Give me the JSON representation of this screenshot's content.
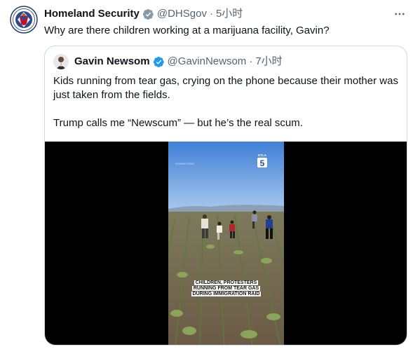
{
  "tweet": {
    "author_name": "Homeland Security",
    "handle": "@DHSgov",
    "separator": "·",
    "time": "5小时",
    "text": "Why are there children working at a marijuana facility, Gavin?",
    "avatar_icon": "dhs-seal-icon",
    "badge_icon": "gray-verified-badge-icon",
    "more_icon": "more-horizontal-icon"
  },
  "quote": {
    "author_name": "Gavin Newsom",
    "handle": "@GavinNewsom",
    "separator": "·",
    "time": "7小时",
    "badge_icon": "blue-verified-badge-icon",
    "text_line1": "Kids running from tear gas, crying on the phone because their mother was just taken from the fields.",
    "text_line2": "Trump calls me “Newscum” — but he’s the real scum.",
    "video": {
      "channel_logo_text": "KTLA 5",
      "caption": "CHILDREN, PROTESTERS RUNNING FROM TEAR GAS DURING IMMIGRATION RAID",
      "watermark": "NYMENTIONS"
    }
  },
  "colors": {
    "text": "#0f1419",
    "muted": "#536471",
    "border": "#cfd9de",
    "verified_blue": "#1d9bf0",
    "verified_gray": "#829aab"
  }
}
